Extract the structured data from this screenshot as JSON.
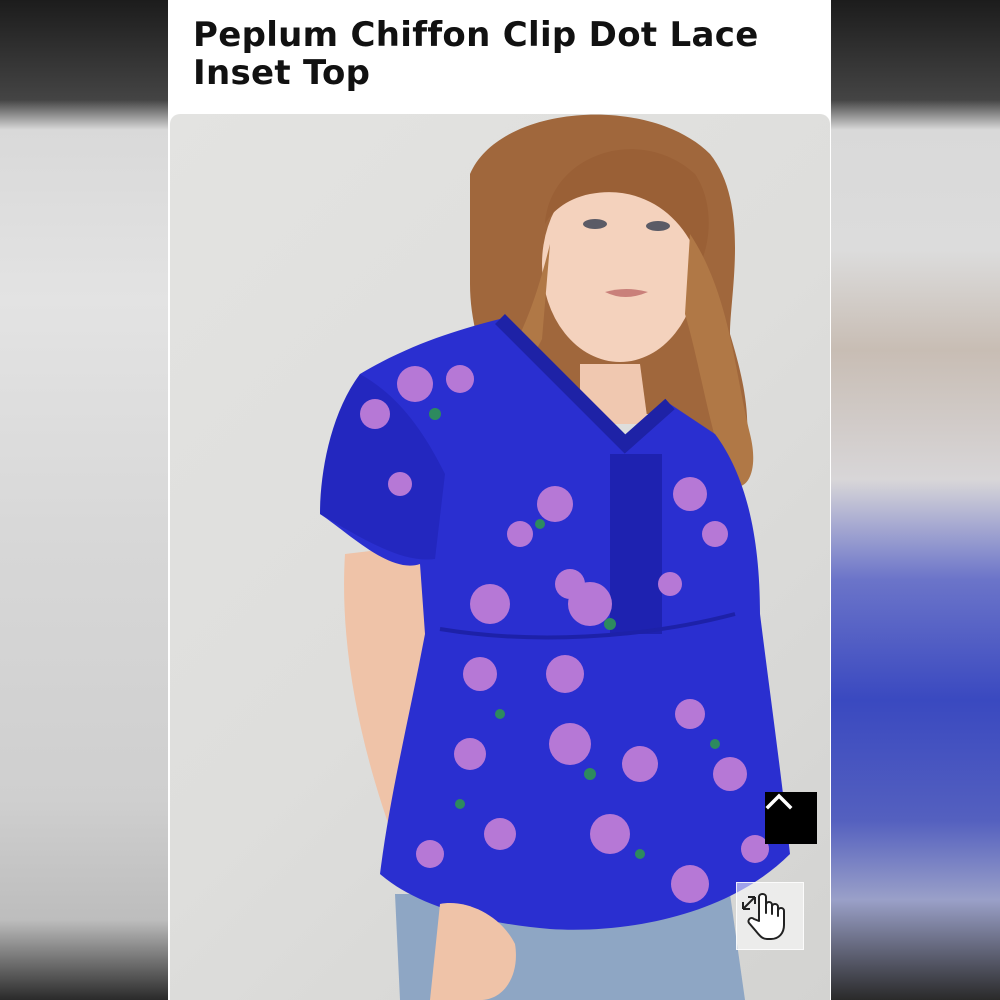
{
  "product": {
    "title": "Peplum Chiffon Clip Dot Lace Inset Top"
  },
  "image": {
    "alt": "Model wearing a cobalt blue peplum chiffon top with purple floral print and lace inset"
  },
  "controls": {
    "scroll_top_icon": "chevron-up-icon",
    "zoom_icon": "hand-pointer-expand-icon"
  },
  "colors": {
    "garment": "#2a2fd0",
    "flower": "#b678d6",
    "button": "#000000"
  }
}
